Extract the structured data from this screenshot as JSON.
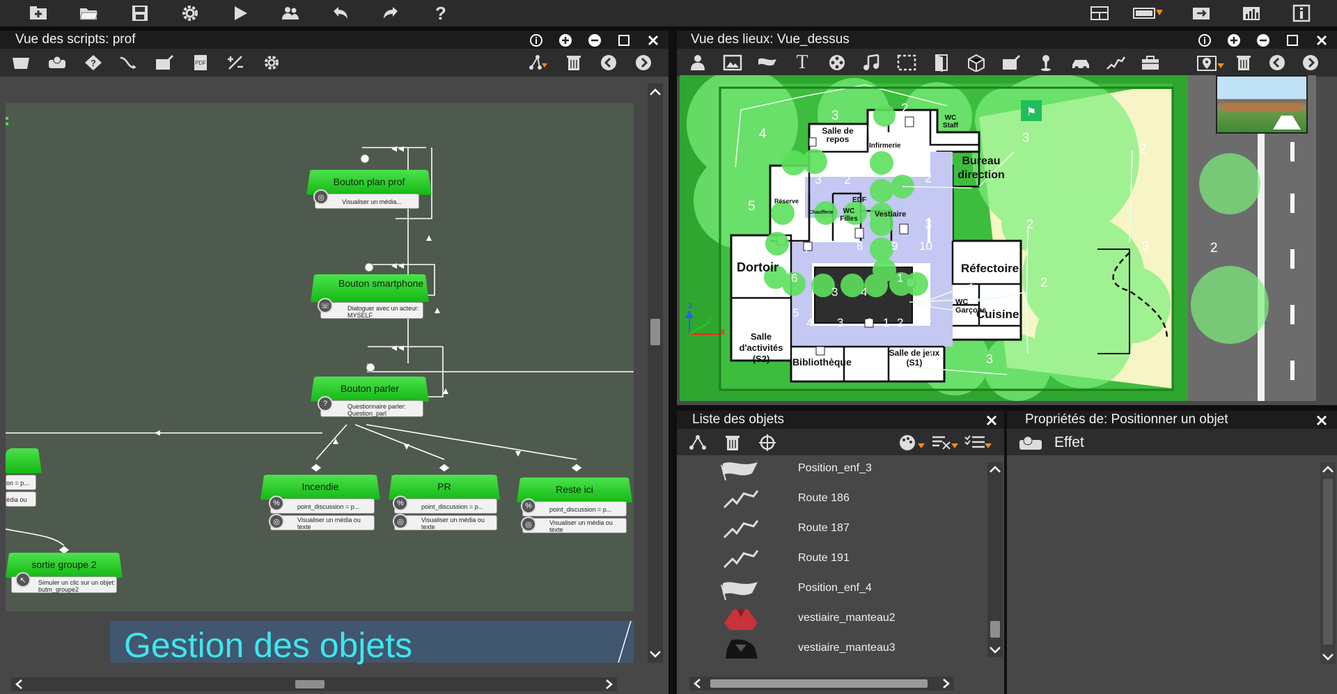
{
  "colors": {
    "node_green": "#2ed12e",
    "canvas_bg": "#4e5a4d",
    "banner_bg": "#41566f",
    "banner_text": "#3fe6ec",
    "map_grass": "#2fa62f",
    "accent_orange": "#ff8c1a"
  },
  "top_toolbar": {
    "icons": [
      "add-scenario-icon",
      "open-folder-icon",
      "save-icon",
      "settings-gear-icon",
      "play-icon",
      "users-icon",
      "undo-icon",
      "redo-icon",
      "help-icon"
    ],
    "help_glyph": "?",
    "right_icons": [
      "layout-icon",
      "window-toggle-icon",
      "import-icon",
      "chart-icon",
      "info-icon"
    ]
  },
  "scripts_panel": {
    "title": "Vue des scripts: prof",
    "banner_text": "Gestion des objets",
    "nodes": [
      {
        "title": "Bouton plan prof",
        "body": "Visualiser un média..."
      },
      {
        "title": "Bouton smartphone",
        "body": "Dialoguer avec un acteur: MYSELF"
      },
      {
        "title": "Bouton parler",
        "body": "Questionnaire parler: Question_parl",
        "badge": "?"
      },
      {
        "title": "Incendie",
        "body1": "point_discussion = p...",
        "body2": "Visualiser un média ou texte"
      },
      {
        "title": "PR",
        "body1": "point_discussion = p...",
        "body2": "Visualiser un média ou texte"
      },
      {
        "title": "Reste ici",
        "body1": "point_discussion = p...",
        "body2": "Visualiser un média ou texte"
      },
      {
        "title": "sortie groupe 2",
        "body": "Simuler un clic sur un objet: butm_groupe2"
      },
      {
        "body1": "on = p...",
        "body2": "édia ou"
      }
    ]
  },
  "places_panel": {
    "title": "Vue des lieux: Vue_dessus",
    "rooms": {
      "salle_repos": "Salle de repos",
      "infirmerie": "Infirmerie",
      "wc_staff": "WC Staff",
      "bureau": "Bureau direction",
      "reserve": "Réserve",
      "chaufferie": "Chaufferie",
      "edf": "EDF",
      "wc_filles": "WC Filles",
      "vestiaire": "Vestiaire",
      "dortoir": "Dortoir",
      "refectoire": "Réfectoire",
      "wc_garcons": "WC Garçons",
      "cuisine": "Cuisine",
      "salle_activites": "Salle d'activités (S2)",
      "bibliotheque": "Bibliothèque",
      "salle_jeux": "Salle de jeux (S1)"
    },
    "path_numbers": [
      "3",
      "2",
      "4",
      "5",
      "3",
      "2",
      "2",
      "3",
      "2",
      "7",
      "8",
      "9",
      "10",
      "6",
      "4",
      "5",
      "6",
      "5",
      "4",
      "3",
      "2",
      "1",
      "2",
      "4",
      "3",
      "3",
      "2",
      "2",
      "3",
      "2",
      "1",
      "4",
      "3"
    ],
    "axis_z": "Z",
    "axis_y": "Y",
    "axis_x": "X"
  },
  "object_list": {
    "title": "Liste des objets",
    "items": [
      {
        "label": "Position_enf_3",
        "icon": "position-flag-icon"
      },
      {
        "label": "Route 186",
        "icon": "route-icon"
      },
      {
        "label": "Route 187",
        "icon": "route-icon"
      },
      {
        "label": "Route 191",
        "icon": "route-icon"
      },
      {
        "label": "Position_enf_4",
        "icon": "position-flag-icon"
      },
      {
        "label": "vestiaire_manteau2",
        "icon": "red-coat-icon"
      },
      {
        "label": "vestiaire_manteau3",
        "icon": "black-coat-icon"
      }
    ]
  },
  "properties_panel": {
    "title": "Propriétés de: Positionner un objet",
    "effect_label": "Effet"
  }
}
